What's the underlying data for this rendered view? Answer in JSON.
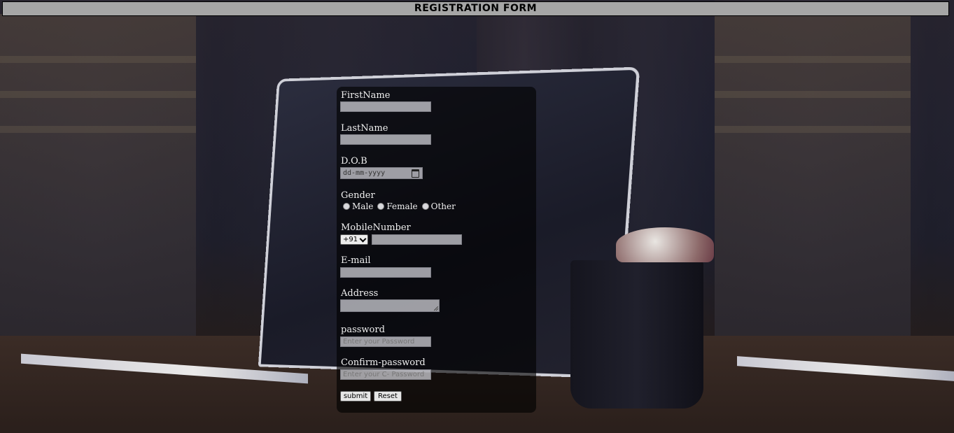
{
  "header": {
    "title": "REGISTRATION FORM"
  },
  "form": {
    "first_name": {
      "label": "FirstName",
      "value": ""
    },
    "last_name": {
      "label": "LastName",
      "value": ""
    },
    "dob": {
      "label": "D.O.B",
      "placeholder": "dd-mm-yyyy"
    },
    "gender": {
      "label": "Gender",
      "options": [
        "Male",
        "Female",
        "Other"
      ]
    },
    "mobile": {
      "label": "MobileNumber",
      "country_code": "+91",
      "value": ""
    },
    "email": {
      "label": "E-mail",
      "value": ""
    },
    "address": {
      "label": "Address",
      "value": ""
    },
    "password": {
      "label": "password",
      "placeholder": "Enter your Password"
    },
    "confirm_password": {
      "label": "Confirm-password",
      "placeholder": "Enter your C- Password"
    },
    "buttons": {
      "submit": "submit",
      "reset": "Reset"
    }
  },
  "colors": {
    "header_bg": "#a6a6a6",
    "card_bg": "rgba(0,0,0,0.62)",
    "label": "#f0f0f0"
  }
}
